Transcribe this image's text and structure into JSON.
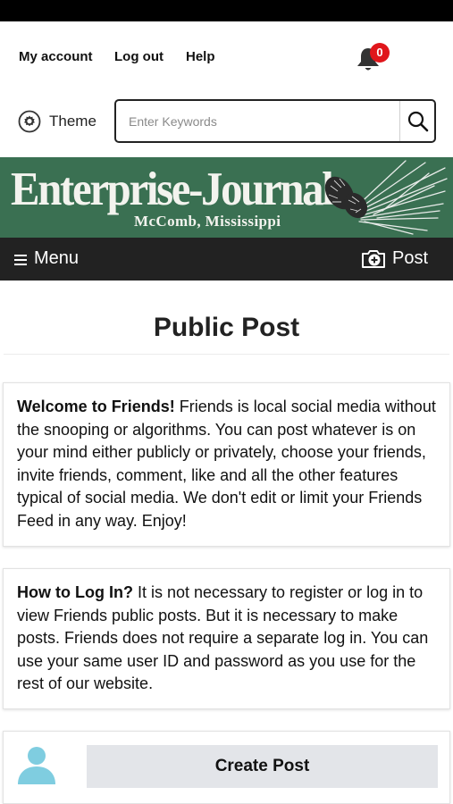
{
  "top_links": {
    "my_account": "My account",
    "log_out": "Log out",
    "help": "Help",
    "notifications_count": "0"
  },
  "theme": {
    "label": "Theme"
  },
  "search": {
    "placeholder": "Enter Keywords"
  },
  "masthead": {
    "title": "Enterprise-Journal",
    "subtitle": "McComb, Mississippi",
    "background": "#3a7052"
  },
  "menubar": {
    "menu_label": "Menu",
    "post_label": "Post"
  },
  "page": {
    "title": "Public Post"
  },
  "cards": {
    "welcome": {
      "heading": "Welcome to Friends!",
      "body": " Friends is local social media without the snooping or algorithms. You can post whatever is on your mind either publicly or privately, choose your friends, invite friends, comment, like and all the other features typical of social media. We don't edit or limit your Friends Feed in any way. Enjoy!"
    },
    "login": {
      "heading": "How to Log In?",
      "body": " It is not necessary to register or log in to view Friends public posts. But it is necessary to make posts. Friends does not require a separate log in. You can use your same user ID and password as you use for the rest of our website."
    },
    "create": {
      "button_label": "Create Post"
    }
  },
  "icons": {
    "bell": "bell-icon",
    "theme": "gear-icon",
    "search": "search-icon",
    "menu": "hamburger-icon",
    "post": "add-post-icon",
    "avatar": "user-avatar-icon"
  },
  "colors": {
    "badge": "#e0161b",
    "menubar": "#222222",
    "avatar": "#7fcde0"
  }
}
